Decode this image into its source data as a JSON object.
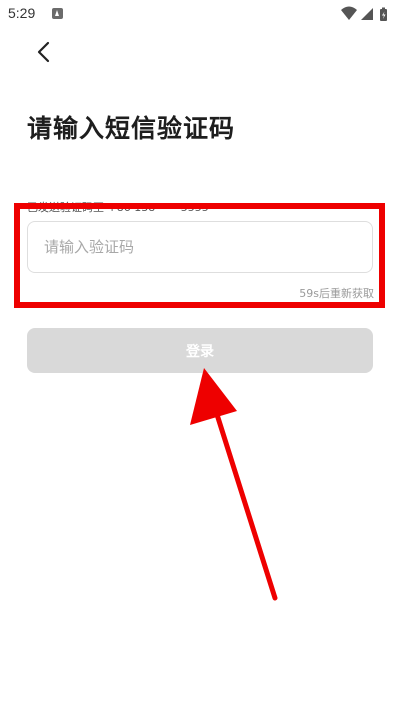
{
  "status_bar": {
    "time": "5:29",
    "icons": [
      "app-notification-icon",
      "wifi-icon",
      "signal-icon",
      "battery-icon"
    ]
  },
  "header": {
    "back_icon": "chevron-left-icon"
  },
  "title": "请输入短信验证码",
  "sent_to_text": "已发送验证码至 +86 138 ****5555",
  "code_input": {
    "placeholder": "请输入验证码",
    "value": ""
  },
  "resend_countdown": "59s后重新获取",
  "login_button": {
    "label": "登录",
    "enabled": false
  },
  "annotation": {
    "highlight_color": "#ee0000",
    "arrow_color": "#ee0000"
  },
  "colors": {
    "button_disabled_bg": "#d9d9d9",
    "input_border": "#dedede",
    "placeholder_text": "#a8a8a8",
    "countdown_text": "#9a9a9a"
  }
}
